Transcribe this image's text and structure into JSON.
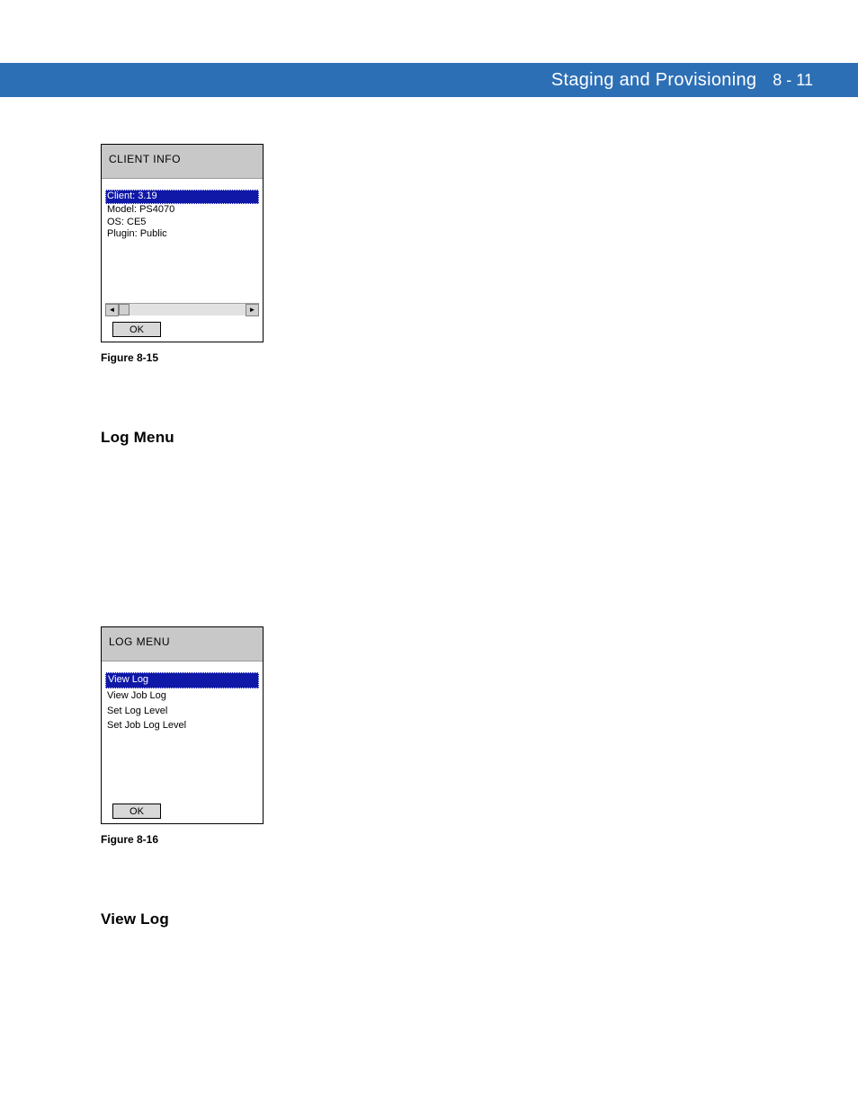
{
  "header": {
    "title": "Staging and Provisioning",
    "page_ref": "8 - 11"
  },
  "figure1": {
    "dialog_title": "CLIENT INFO",
    "lines": {
      "selected": "Client: 3.19",
      "l2": "Model: PS4070",
      "l3": "OS: CE5",
      "l4": "Plugin: Public"
    },
    "ok_label": "OK",
    "caption": "Figure 8-15",
    "scroll_left_glyph": "◄",
    "scroll_right_glyph": "►"
  },
  "section_log_menu": "Log Menu",
  "figure2": {
    "dialog_title": "LOG MENU",
    "menu": {
      "selected": "View Log",
      "i2": "View Job Log",
      "i3": "Set Log Level",
      "i4": "Set Job Log Level"
    },
    "ok_label": "OK",
    "caption": "Figure 8-16"
  },
  "section_view_log": "View Log"
}
